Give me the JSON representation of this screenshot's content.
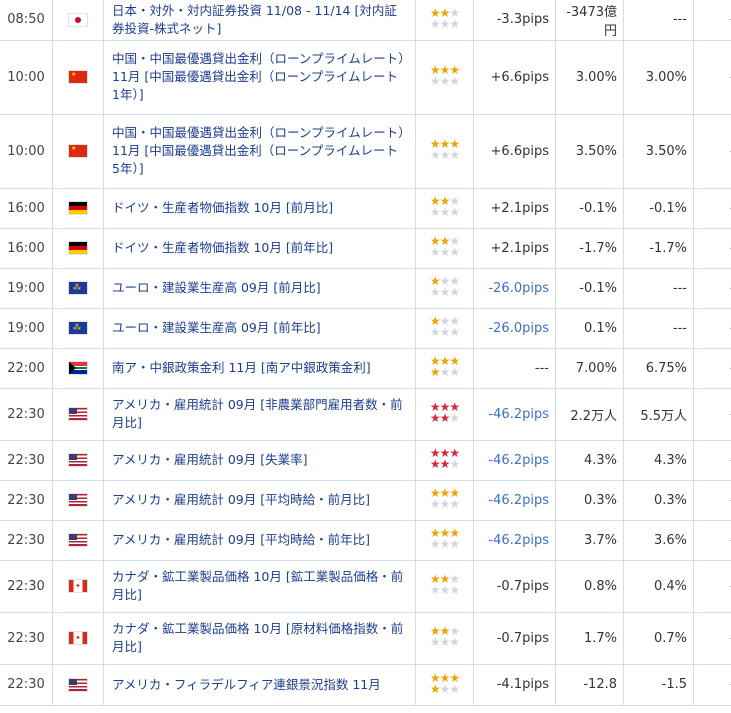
{
  "rows": [
    {
      "time": "08:50",
      "flag": "jp",
      "flag_icon": "japan-flag-icon",
      "name": "日本・対外・対内証券投資 11/08 - 11/14 [対内証券投資-株式ネット]",
      "stars": 2,
      "star_color": "gold",
      "pips": "-3.3pips",
      "pips_dir": "pos",
      "prev": "-3473億円",
      "fore": "---",
      "act": "---",
      "height": 40
    },
    {
      "time": "10:00",
      "flag": "cn",
      "flag_icon": "china-flag-icon",
      "name": "中国・中国最優遇貸出金利（ローンプライムレート）11月 [中国最優遇貸出金利（ローンプライムレート　1年）]",
      "stars": 3,
      "star_color": "gold",
      "pips": "+6.6pips",
      "pips_dir": "pos",
      "prev": "3.00%",
      "fore": "3.00%",
      "act": "---",
      "height": 74
    },
    {
      "time": "10:00",
      "flag": "cn",
      "flag_icon": "china-flag-icon",
      "name": "中国・中国最優遇貸出金利（ローンプライムレート）11月 [中国最優遇貸出金利（ローンプライムレート　5年）]",
      "stars": 3,
      "star_color": "gold",
      "pips": "+6.6pips",
      "pips_dir": "pos",
      "prev": "3.50%",
      "fore": "3.50%",
      "act": "---",
      "height": 74
    },
    {
      "time": "16:00",
      "flag": "de",
      "flag_icon": "germany-flag-icon",
      "name": "ドイツ・生産者物価指数 10月 [前月比]",
      "stars": 2,
      "star_color": "gold",
      "pips": "+2.1pips",
      "pips_dir": "pos",
      "prev": "-0.1%",
      "fore": "-0.1%",
      "act": "---",
      "height": 40
    },
    {
      "time": "16:00",
      "flag": "de",
      "flag_icon": "germany-flag-icon",
      "name": "ドイツ・生産者物価指数 10月 [前年比]",
      "stars": 2,
      "star_color": "gold",
      "pips": "+2.1pips",
      "pips_dir": "pos",
      "prev": "-1.7%",
      "fore": "-1.7%",
      "act": "---",
      "height": 40
    },
    {
      "time": "19:00",
      "flag": "eu",
      "flag_icon": "eu-flag-icon",
      "name": "ユーロ・建設業生産高 09月 [前月比]",
      "stars": 1,
      "star_color": "gold",
      "pips": "-26.0pips",
      "pips_dir": "neg",
      "prev": "-0.1%",
      "fore": "---",
      "act": "---",
      "height": 40
    },
    {
      "time": "19:00",
      "flag": "eu",
      "flag_icon": "eu-flag-icon",
      "name": "ユーロ・建設業生産高 09月 [前年比]",
      "stars": 1,
      "star_color": "gold",
      "pips": "-26.0pips",
      "pips_dir": "neg",
      "prev": "0.1%",
      "fore": "---",
      "act": "---",
      "height": 40
    },
    {
      "time": "22:00",
      "flag": "za",
      "flag_icon": "south-africa-flag-icon",
      "name": "南ア・中銀政策金利 11月 [南ア中銀政策金利]",
      "stars": 4,
      "star_color": "gold",
      "pips": "---",
      "pips_dir": "pos",
      "prev": "7.00%",
      "fore": "6.75%",
      "act": "---",
      "height": 40
    },
    {
      "time": "22:30",
      "flag": "us",
      "flag_icon": "usa-flag-icon",
      "name": "アメリカ・雇用統計 09月 [非農業部門雇用者数・前月比]",
      "stars": 5,
      "star_color": "red",
      "pips": "-46.2pips",
      "pips_dir": "neg",
      "prev": "2.2万人",
      "fore": "5.5万人",
      "act": "---",
      "height": 52
    },
    {
      "time": "22:30",
      "flag": "us",
      "flag_icon": "usa-flag-icon",
      "name": "アメリカ・雇用統計 09月 [失業率]",
      "stars": 5,
      "star_color": "red",
      "pips": "-46.2pips",
      "pips_dir": "neg",
      "prev": "4.3%",
      "fore": "4.3%",
      "act": "---",
      "height": 40
    },
    {
      "time": "22:30",
      "flag": "us",
      "flag_icon": "usa-flag-icon",
      "name": "アメリカ・雇用統計 09月 [平均時給・前月比]",
      "stars": 3,
      "star_color": "gold",
      "pips": "-46.2pips",
      "pips_dir": "neg",
      "prev": "0.3%",
      "fore": "0.3%",
      "act": "---",
      "height": 40
    },
    {
      "time": "22:30",
      "flag": "us",
      "flag_icon": "usa-flag-icon",
      "name": "アメリカ・雇用統計 09月 [平均時給・前年比]",
      "stars": 3,
      "star_color": "gold",
      "pips": "-46.2pips",
      "pips_dir": "neg",
      "prev": "3.7%",
      "fore": "3.6%",
      "act": "---",
      "height": 40
    },
    {
      "time": "22:30",
      "flag": "ca",
      "flag_icon": "canada-flag-icon",
      "name": "カナダ・鉱工業製品価格 10月 [鉱工業製品価格・前月比]",
      "stars": 2,
      "star_color": "gold",
      "pips": "-0.7pips",
      "pips_dir": "pos",
      "prev": "0.8%",
      "fore": "0.4%",
      "act": "---",
      "height": 52
    },
    {
      "time": "22:30",
      "flag": "ca",
      "flag_icon": "canada-flag-icon",
      "name": "カナダ・鉱工業製品価格 10月 [原材料価格指数・前月比]",
      "stars": 2,
      "star_color": "gold",
      "pips": "-0.7pips",
      "pips_dir": "pos",
      "prev": "1.7%",
      "fore": "0.7%",
      "act": "---",
      "height": 52
    },
    {
      "time": "22:30",
      "flag": "us",
      "flag_icon": "usa-flag-icon",
      "name": "アメリカ・フィラデルフィア連銀景況指数 11月",
      "stars": 4,
      "star_color": "gold",
      "pips": "-4.1pips",
      "pips_dir": "pos",
      "prev": "-12.8",
      "fore": "-1.5",
      "act": "---",
      "height": 41
    }
  ]
}
